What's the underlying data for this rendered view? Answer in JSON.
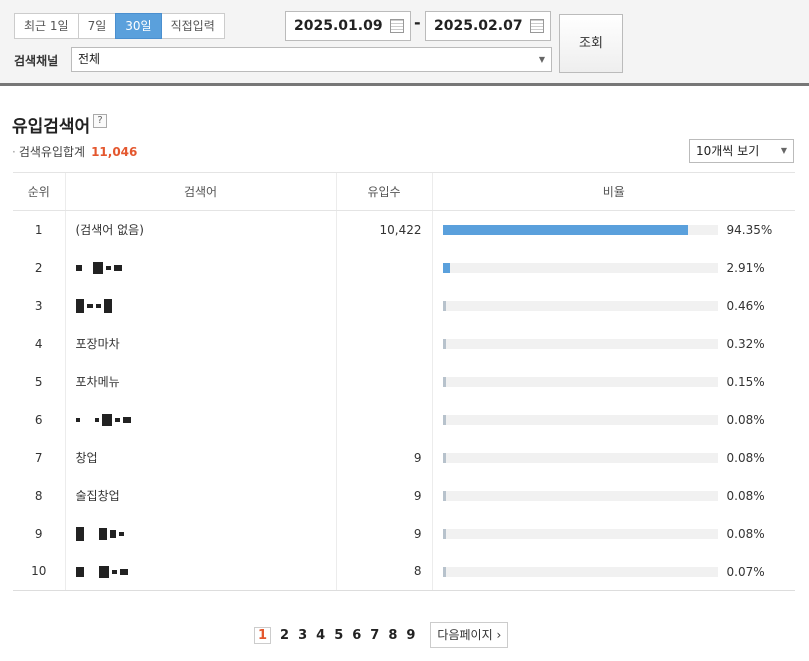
{
  "filter": {
    "periods": [
      "최근 1일",
      "7일",
      "30일",
      "직접입력"
    ],
    "active_period": 2,
    "start_date": "2025.01.09",
    "end_date": "2025.02.07",
    "date_separator": "-",
    "search_button": "조회",
    "channel_label": "검색채널",
    "channel_value": "전체"
  },
  "section": {
    "title": "유입검색어",
    "help": "?",
    "total_label": "검색유입합계",
    "total_value": "11,046",
    "per_page": "10개씩 보기"
  },
  "table": {
    "headers": [
      "순위",
      "검색어",
      "유입수",
      "비율"
    ],
    "rows": [
      {
        "rank": "1",
        "keyword": "(검색어 없음)",
        "count": "10,422",
        "ratio": 94.35,
        "ratio_label": "94.35%",
        "masked": false
      },
      {
        "rank": "2",
        "keyword": "",
        "count": "",
        "ratio": 2.91,
        "ratio_label": "2.91%",
        "masked": true
      },
      {
        "rank": "3",
        "keyword": "",
        "count": "",
        "ratio": 0.46,
        "ratio_label": "0.46%",
        "masked": true
      },
      {
        "rank": "4",
        "keyword": "포장마차",
        "count": "",
        "ratio": 0.32,
        "ratio_label": "0.32%",
        "masked": false
      },
      {
        "rank": "5",
        "keyword": "포차메뉴",
        "count": "",
        "ratio": 0.15,
        "ratio_label": "0.15%",
        "masked": false
      },
      {
        "rank": "6",
        "keyword": "",
        "count": "",
        "ratio": 0.08,
        "ratio_label": "0.08%",
        "masked": true
      },
      {
        "rank": "7",
        "keyword": "창업",
        "count": "9",
        "ratio": 0.08,
        "ratio_label": "0.08%",
        "masked": false
      },
      {
        "rank": "8",
        "keyword": "술집창업",
        "count": "9",
        "ratio": 0.08,
        "ratio_label": "0.08%",
        "masked": false
      },
      {
        "rank": "9",
        "keyword": "",
        "count": "9",
        "ratio": 0.08,
        "ratio_label": "0.08%",
        "masked": true
      },
      {
        "rank": "10",
        "keyword": "",
        "count": "8",
        "ratio": 0.07,
        "ratio_label": "0.07%",
        "masked": true
      }
    ]
  },
  "pagination": {
    "pages": [
      "1",
      "2",
      "3",
      "4",
      "5",
      "6",
      "7",
      "8",
      "9"
    ],
    "current": "1",
    "next_label": "다음페이지"
  },
  "colors": {
    "accent": "#5aa0dc",
    "highlight": "#e4572e",
    "bar_minor": "#b7c2cc"
  }
}
